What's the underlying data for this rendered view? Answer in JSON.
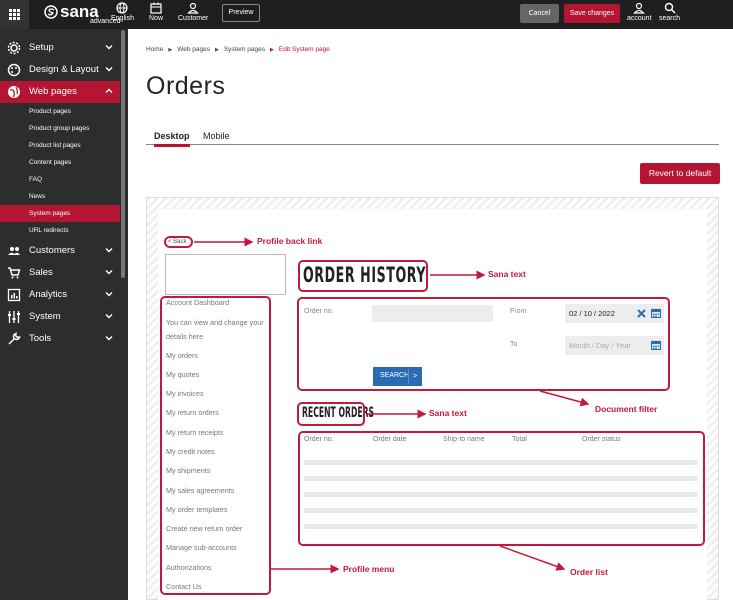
{
  "topbar": {
    "grid_icon": "grid-icon",
    "logo_main": "sana",
    "logo_sub": "advanced",
    "language_label": "English",
    "now_label": "Now",
    "customer_label": "Customer",
    "preview_label": "Preview",
    "cancel_label": "Cancel",
    "save_label": "Save changes",
    "account_label": "account",
    "search_label": "search",
    "accent_color": "#b41532"
  },
  "sidebar": {
    "items": [
      {
        "label": "Setup",
        "icon": "gear-icon"
      },
      {
        "label": "Design & Layout",
        "icon": "palette-icon"
      },
      {
        "label": "Web pages",
        "icon": "globe-icon"
      },
      {
        "label": "Customers",
        "icon": "users-icon"
      },
      {
        "label": "Sales",
        "icon": "cart-icon"
      },
      {
        "label": "Analytics",
        "icon": "chart-icon"
      },
      {
        "label": "System",
        "icon": "sliders-icon"
      },
      {
        "label": "Tools",
        "icon": "wrench-icon"
      }
    ],
    "subitems": [
      "Product pages",
      "Product group pages",
      "Product list pages",
      "Content pages",
      "FAQ",
      "News",
      "System pages",
      "URL redirects"
    ]
  },
  "breadcrumb": [
    "Home",
    "Web pages",
    "System pages",
    "Edit System page"
  ],
  "page_title": "Orders",
  "tabs": [
    "Desktop",
    "Mobile"
  ],
  "revert_label": "Revert to default",
  "preview": {
    "back_link": "< Back",
    "order_history": "ORDER HISTORY",
    "recent_orders": "RECENT ORDERS",
    "profile_menu": [
      "Account Dashboard",
      "You can view and change your",
      "details here",
      "My orders",
      "My quotes",
      "My invoices",
      "My return orders",
      "My return receipts",
      "My credit notes",
      "My shipments",
      "My sales agreements",
      "My order templates",
      "Create new return order",
      "Manage sub-accounts",
      "Authorizations",
      "Contact Us"
    ],
    "filter": {
      "order_no_label": "Order no.",
      "from_label": "From",
      "to_label": "To",
      "from_value": "02 / 10 / 2022",
      "to_placeholder": "Month / Day / Year",
      "search_label": "SEARCH",
      "search_arrow": ">"
    },
    "columns": [
      "Order no.",
      "Order date",
      "Ship-to name",
      "Total",
      "Order status"
    ]
  },
  "annotations": {
    "profile_back_link": "Profile back link",
    "sana_text_1": "Sana text",
    "sana_text_2": "Sana text",
    "document_filter": "Document filter",
    "profile_menu": "Profile menu",
    "order_list": "Order list"
  }
}
